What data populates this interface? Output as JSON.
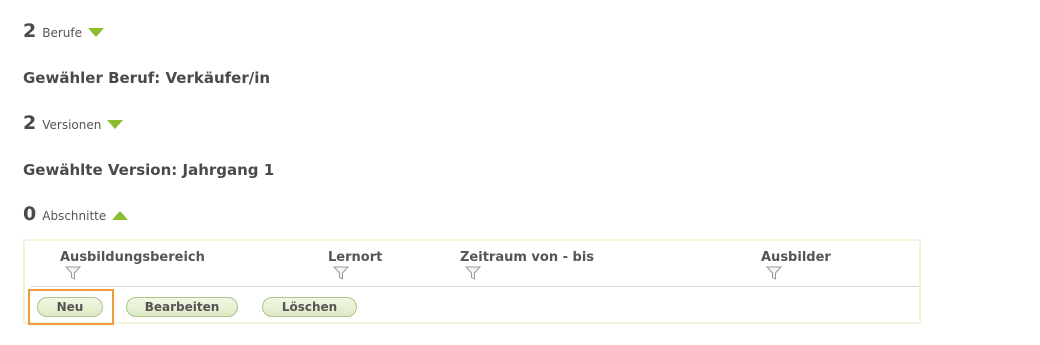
{
  "berufe": {
    "count": "2",
    "label": "Berufe",
    "toggle_icon": "triangle-down-icon"
  },
  "selected_beruf": "Gewähler Beruf: Verkäufer/in",
  "versionen": {
    "count": "2",
    "label": "Versionen",
    "toggle_icon": "triangle-down-icon"
  },
  "selected_version": "Gewählte Version: Jahrgang 1",
  "abschnitte": {
    "count": "0",
    "label": "Abschnitte",
    "toggle_icon": "triangle-up-icon"
  },
  "table": {
    "columns": [
      {
        "label": "Ausbildungsbereich",
        "icon": "filter-icon"
      },
      {
        "label": "Lernort",
        "icon": "filter-icon"
      },
      {
        "label": "Zeitraum von - bis",
        "icon": "filter-icon"
      },
      {
        "label": "Ausbilder",
        "icon": "filter-icon"
      }
    ]
  },
  "buttons": {
    "new": "Neu",
    "edit": "Bearbeiten",
    "delete": "Löschen"
  },
  "colors": {
    "accent_green": "#8cbd2c",
    "highlight_orange": "#f29a38"
  }
}
